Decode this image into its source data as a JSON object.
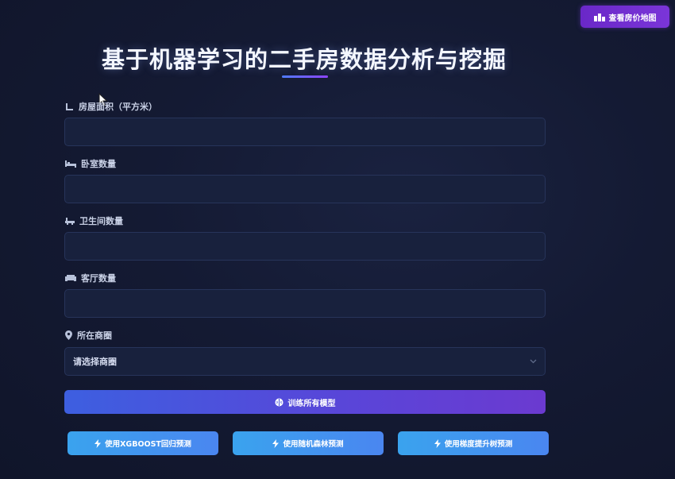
{
  "header": {
    "map_button_label": "查看房价地图",
    "title": "基于机器学习的二手房数据分析与挖掘"
  },
  "form": {
    "fields": [
      {
        "label": "房屋面积（平方米）",
        "value": ""
      },
      {
        "label": "卧室数量",
        "value": ""
      },
      {
        "label": "卫生间数量",
        "value": ""
      },
      {
        "label": "客厅数量",
        "value": ""
      }
    ],
    "district": {
      "label": "所在商圈",
      "selected": "请选择商圈"
    }
  },
  "actions": {
    "train_label": "训练所有模型",
    "predict_buttons": [
      {
        "label": "使用XGBOOST回归预测"
      },
      {
        "label": "使用随机森林预测"
      },
      {
        "label": "使用梯度提升树预测"
      }
    ]
  },
  "colors": {
    "background": "#141a33",
    "accent_purple": "#6a28c8",
    "accent_blue": "#3d5fe0",
    "predict_blue": "#3aa3ee"
  }
}
